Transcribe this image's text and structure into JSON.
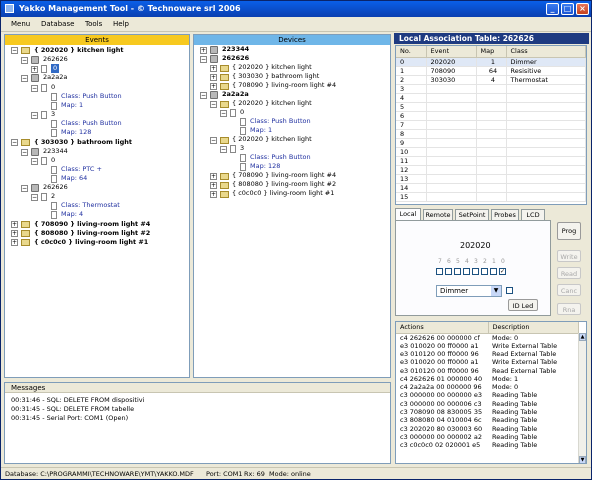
{
  "window": {
    "title": "Yakko Management Tool - © Technoware srl 2006",
    "min": "_",
    "max": "□",
    "close": "×"
  },
  "menu": [
    "Menu",
    "Database",
    "Tools",
    "Help"
  ],
  "events": {
    "header": "Events",
    "nodes": {
      "n1": "{ 202020 } kitchen light",
      "n1a": "262626",
      "n1a0": "0",
      "n1b": "2a2a2a",
      "n1b0": "0",
      "n1b0c": "Class: Push Button",
      "n1b0m": "Map: 1",
      "n1b3": "3",
      "n1b3c": "Class: Push Button",
      "n1b3m": "Map: 128",
      "n2": "{ 303030 } bathroom light",
      "n2a": "223344",
      "n2a0": "0",
      "n2a0c": "Class: PTC +",
      "n2a0m": "Map: 64",
      "n2b": "262626",
      "n2b2": "2",
      "n2b2c": "Class: Thermostat",
      "n2b2m": "Map: 4",
      "n3": "{ 708090 } living-room light #4",
      "n4": "{ 808080 } living-room light #2",
      "n5": "{ c0c0c0 } living-room light #1"
    }
  },
  "devices": {
    "header": "Devices",
    "nodes": {
      "d1": "223344",
      "d2": "262626",
      "d2a": "{ 202020 } kitchen light",
      "d2b": "{ 303030 } bathroom light",
      "d2c": "{ 708090 } living-room light #4",
      "d3": "2a2a2a",
      "d3a": "{ 202020 } kitchen light",
      "d3a0": "0",
      "d3a0c": "Class: Push Button",
      "d3a0m": "Map: 1",
      "d3b": "{ 202020 } kitchen light",
      "d3b3": "3",
      "d3b3c": "Class: Push Button",
      "d3b3m": "Map: 128",
      "d3c": "{ 708090 } living-room light #4",
      "d3d": "{ 808080 } living-room light #2",
      "d3e": "{ c0c0c0 } living-room light #1"
    }
  },
  "local_table": {
    "title": "Local Association Table: 262626",
    "columns": [
      "No.",
      "Event",
      "Map",
      "Class"
    ],
    "rows": [
      [
        "0",
        "202020",
        "1",
        "Dimmer"
      ],
      [
        "1",
        "708090",
        "64",
        "Resisitive"
      ],
      [
        "2",
        "303030",
        "4",
        "Thermostat"
      ],
      [
        "3",
        "",
        "",
        ""
      ],
      [
        "4",
        "",
        "",
        ""
      ],
      [
        "5",
        "",
        "",
        ""
      ],
      [
        "6",
        "",
        "",
        ""
      ],
      [
        "7",
        "",
        "",
        ""
      ],
      [
        "8",
        "",
        "",
        ""
      ],
      [
        "9",
        "",
        "",
        ""
      ],
      [
        "10",
        "",
        "",
        ""
      ],
      [
        "11",
        "",
        "",
        ""
      ],
      [
        "12",
        "",
        "",
        ""
      ],
      [
        "13",
        "",
        "",
        ""
      ],
      [
        "14",
        "",
        "",
        ""
      ],
      [
        "15",
        "",
        "",
        ""
      ]
    ]
  },
  "tabs": [
    "Local",
    "Remote",
    "SetPoint",
    "Probes",
    "LCD"
  ],
  "local_tab": {
    "event_value": "202020",
    "bit_labels": [
      "7",
      "6",
      "5",
      "4",
      "3",
      "2",
      "1",
      "0"
    ],
    "checked": [
      false,
      false,
      false,
      false,
      false,
      false,
      false,
      true
    ],
    "class_select": "Dimmer",
    "id_led": "ID Led"
  },
  "side_buttons": {
    "prog": "Prog",
    "write": "Write",
    "read": "Read",
    "canc": "Canc",
    "rna": "Rna"
  },
  "actions": {
    "columns": [
      "Actions",
      "Description"
    ],
    "rows": [
      [
        "c4 262626 00 000000 cf",
        "Mode: 0"
      ],
      [
        "e3 010020 00 ff0000 a1",
        "Write External Table"
      ],
      [
        "e3 010120 00 ff0000 96",
        "Read External Table"
      ],
      [
        "e3 010020 00 ff0000 a1",
        "Write External Table"
      ],
      [
        "e3 010120 00 ff0000 96",
        "Read External Table"
      ],
      [
        "c4 262626 01 000000 40",
        "Mode: 1"
      ],
      [
        "c4 2a2a2a 00 000000 96",
        "Mode: 0"
      ],
      [
        "c3 000000 00 000000 e3",
        "Reading Table"
      ],
      [
        "c3 000000 00 000006 c3",
        "Reading Table"
      ],
      [
        "c3 708090 08 830005 35",
        "Reading Table"
      ],
      [
        "c3 808080 04 010004 6c",
        "Reading Table"
      ],
      [
        "c3 202020 80 030003 60",
        "Reading Table"
      ],
      [
        "c3 000000 00 000002 a2",
        "Reading Table"
      ],
      [
        "c3 c0c0c0 02 020001 e5",
        "Reading Table"
      ]
    ]
  },
  "messages": {
    "header": "Messages",
    "lines": [
      "00:31:46 - SQL: DELETE FROM dispositivi",
      "00:31:45 - SQL: DELETE FROM tabelle",
      "00:31:45 - Serial Port: COM1 (Open)"
    ]
  },
  "status": {
    "database": "Database: C:\\PROGRAMMI\\TECHNOWARE\\YMT\\YAKKO.MDF",
    "port": "Port: COM1",
    "rx": "Rx: 69",
    "mode": "Mode: online"
  }
}
